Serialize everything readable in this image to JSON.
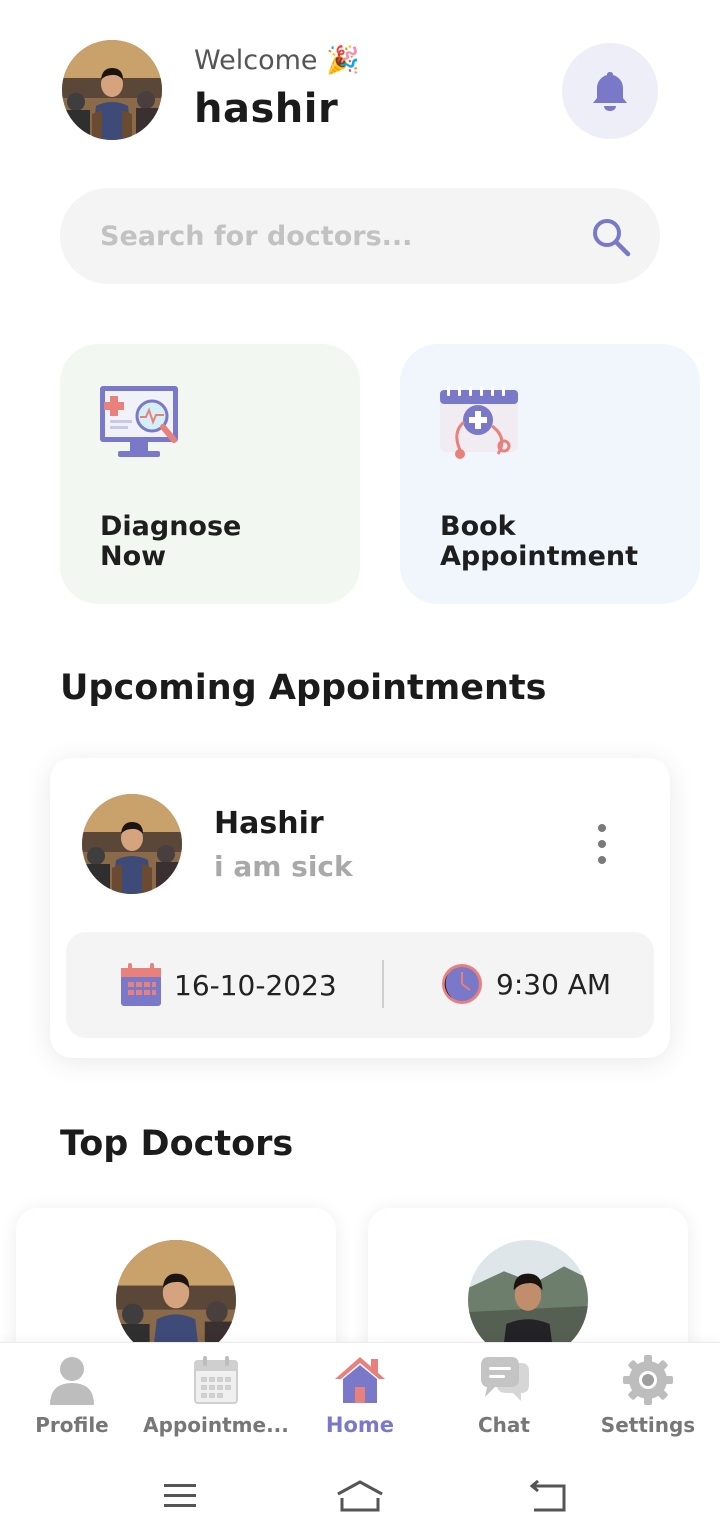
{
  "header": {
    "welcome_text": "Welcome",
    "welcome_emoji": "🎉",
    "username": "hashir",
    "notification_icon": "bell-icon"
  },
  "search": {
    "placeholder": "Search for doctors...",
    "value": "",
    "icon": "search-icon"
  },
  "quick_actions": [
    {
      "label": "Diagnose\nNow",
      "icon": "diagnose-monitor-icon",
      "bg": "#f2f8f1"
    },
    {
      "label": "Book\nAppointment",
      "icon": "calendar-stethoscope-icon",
      "bg": "#f1f6fc"
    }
  ],
  "upcoming": {
    "title": "Upcoming Appointments",
    "appointment": {
      "name": "Hashir",
      "reason": "i am sick",
      "date": "16-10-2023",
      "time": "9:30 AM",
      "more_icon": "more-vertical-icon"
    }
  },
  "top_doctors": {
    "title": "Top Doctors"
  },
  "nav": {
    "items": [
      {
        "label": "Profile",
        "icon": "person-icon"
      },
      {
        "label": "Appointme...",
        "icon": "calendar-icon"
      },
      {
        "label": "Home",
        "icon": "home-icon",
        "active": true
      },
      {
        "label": "Chat",
        "icon": "chat-icon"
      },
      {
        "label": "Settings",
        "icon": "gear-icon"
      }
    ]
  },
  "colors": {
    "accent": "#7a78c9",
    "icon_bg": "#eeeef9",
    "salmon": "#e8817c"
  }
}
